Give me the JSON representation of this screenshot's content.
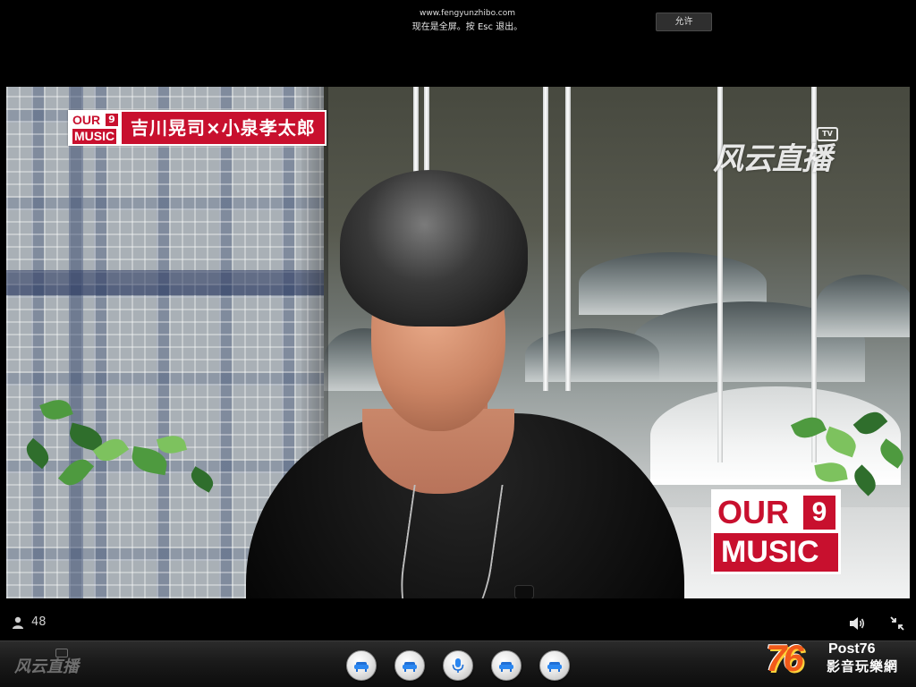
{
  "fullscreen_notice": {
    "url": "www.fengyunzhibo.com",
    "message": "现在是全屏。按 Esc 退出。",
    "allow_button": "允许"
  },
  "video": {
    "title_badge": {
      "logo_top": "OUR",
      "logo_number": "9",
      "logo_bottom": "MUSIC",
      "caption": "吉川晃司×小泉孝太郎"
    },
    "corner_logo": {
      "top": "OUR",
      "number": "9",
      "bottom": "MUSIC"
    },
    "watermark": {
      "text": "风云直播",
      "tv_label": "TV"
    }
  },
  "status": {
    "viewer_count": "48",
    "icons": [
      "user-icon",
      "volume-icon",
      "exit-fullscreen-icon"
    ]
  },
  "control_bar": {
    "brand": "风云直播",
    "buttons": [
      "sofa-icon",
      "sofa-icon",
      "microphone-icon",
      "sofa-icon",
      "sofa-icon"
    ],
    "corner_logo_big": "76",
    "corner_logo_text": "Post76",
    "corner_logo_subtitle": "影音玩樂網"
  },
  "colors": {
    "brand_red": "#c8102e",
    "post76_orange": "#f05a1a"
  }
}
